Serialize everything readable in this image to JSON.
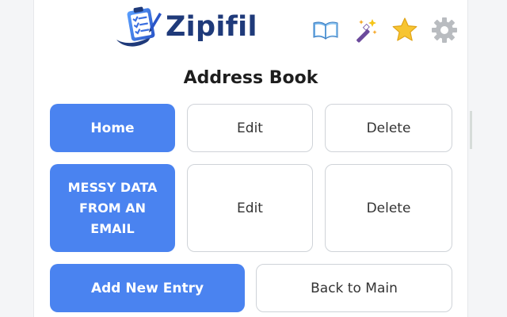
{
  "header": {
    "app_name": "Zipifil",
    "toolbar_icons": [
      "book-icon",
      "magic-wand-icon",
      "star-icon",
      "gear-icon"
    ]
  },
  "page": {
    "title": "Address Book"
  },
  "entries": [
    {
      "name": "Home",
      "edit_label": "Edit",
      "delete_label": "Delete"
    },
    {
      "name": "MESSY DATA\nFROM AN\nEMAIL",
      "edit_label": "Edit",
      "delete_label": "Delete"
    }
  ],
  "actions": {
    "add_label": "Add New Entry",
    "back_label": "Back to Main"
  },
  "colors": {
    "primary": "#4a83f0",
    "logo_text": "#1f3a7a",
    "outline_border": "#cfd3d8"
  }
}
